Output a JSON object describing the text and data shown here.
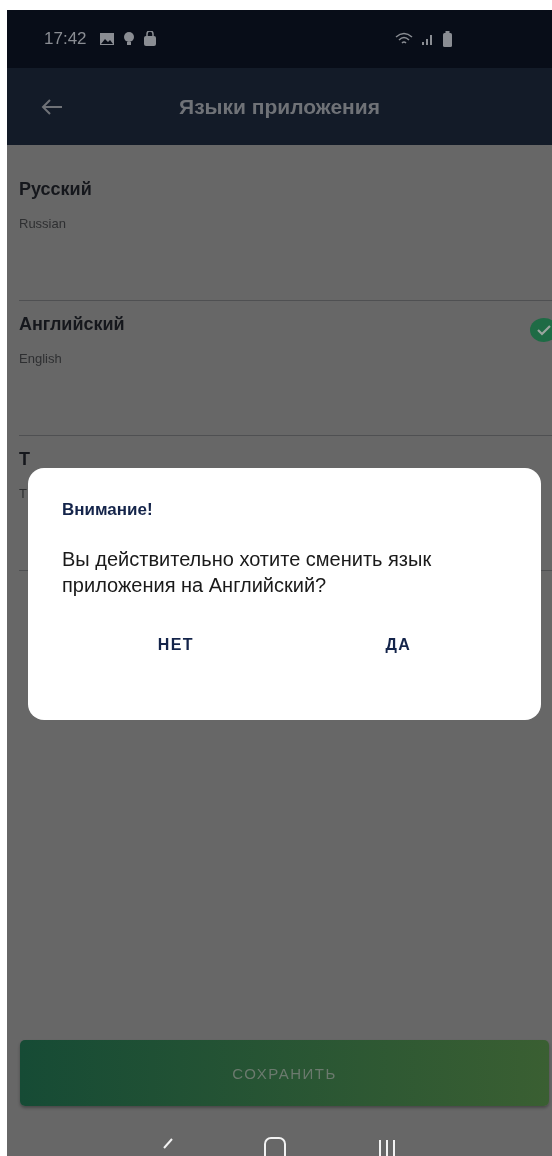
{
  "status_bar": {
    "time": "17:42"
  },
  "app_bar": {
    "title": "Языки приложения"
  },
  "languages": [
    {
      "name": "Русский",
      "subtitle": "Russian",
      "selected": false
    },
    {
      "name": "Английский",
      "subtitle": "English",
      "selected": true
    },
    {
      "name": "Т",
      "subtitle": "T",
      "selected": false
    }
  ],
  "save_button": {
    "label": "СОХРАНИТЬ"
  },
  "dialog": {
    "title": "Внимание!",
    "message": "Вы действительно хотите сменить язык приложения на Английский?",
    "buttons": [
      "НЕТ",
      "ДА"
    ]
  }
}
